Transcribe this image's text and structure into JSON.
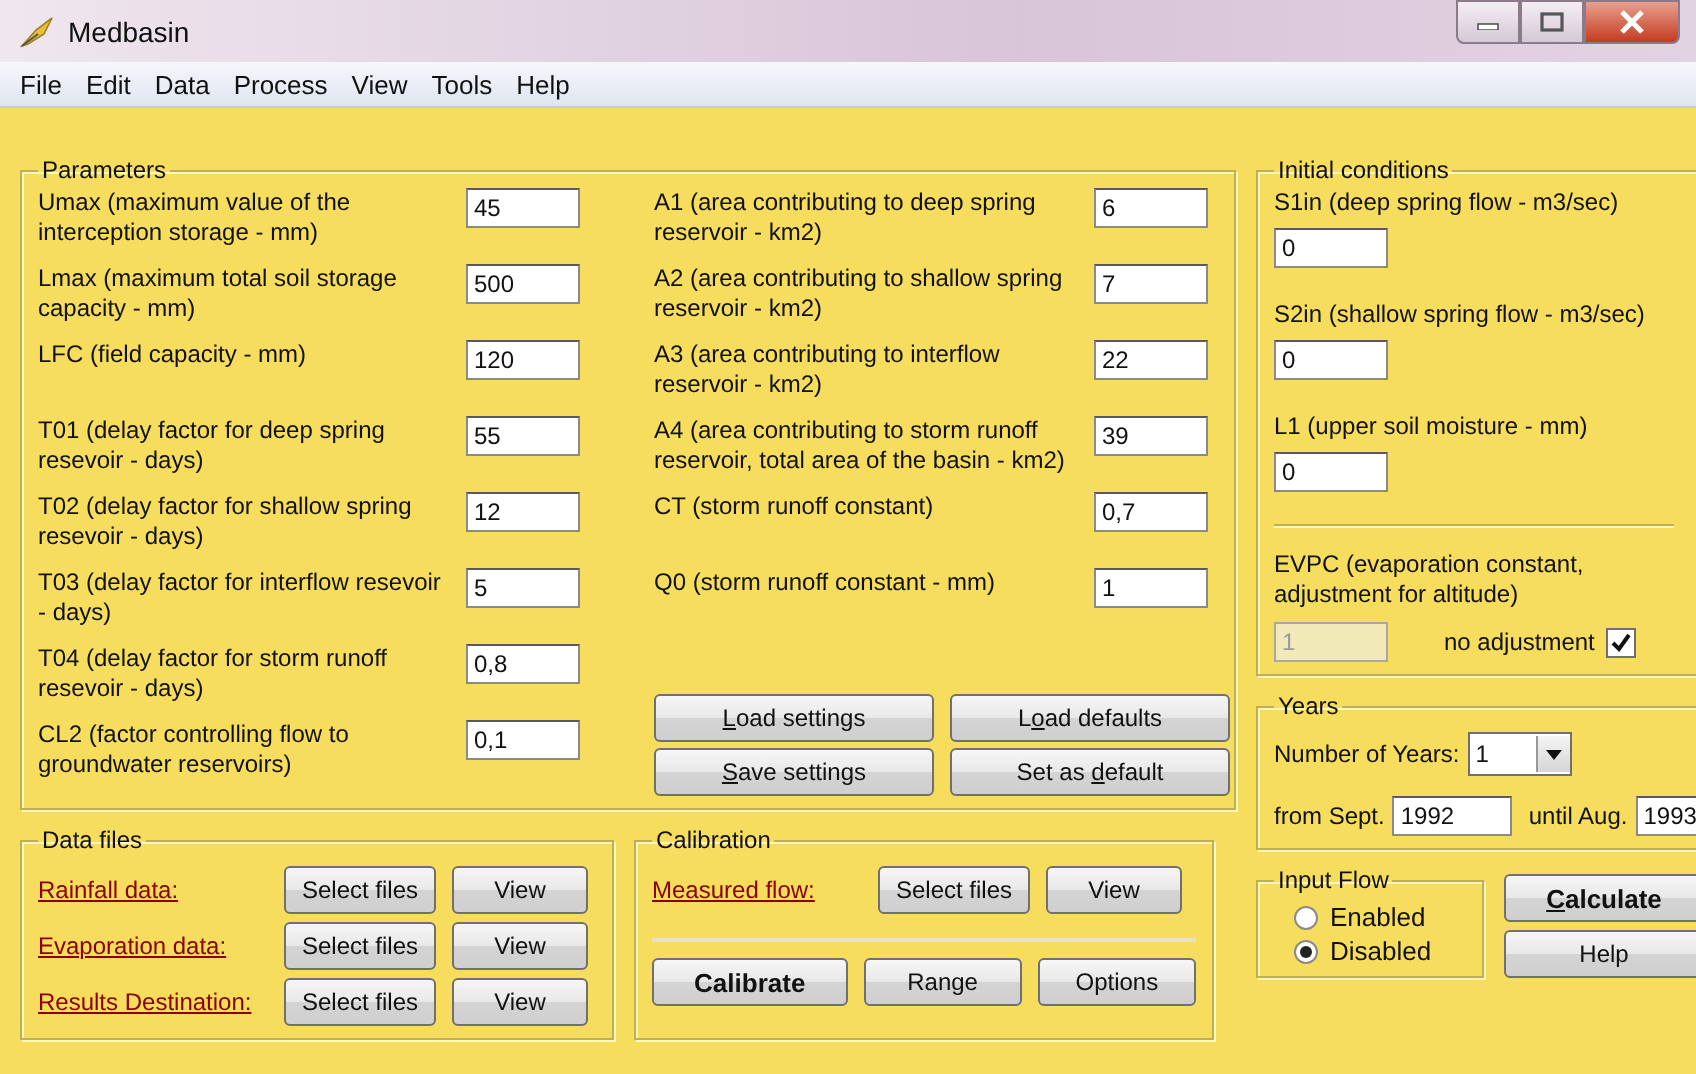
{
  "window": {
    "title": "Medbasin"
  },
  "menu": [
    "File",
    "Edit",
    "Data",
    "Process",
    "View",
    "Tools",
    "Help"
  ],
  "parameters": {
    "title": "Parameters",
    "left": [
      {
        "label": "Umax (maximum value of the interception storage - mm)",
        "value": "45"
      },
      {
        "label": "Lmax (maximum total soil storage capacity - mm)",
        "value": "500"
      },
      {
        "label": "LFC (field capacity - mm)",
        "value": "120"
      },
      {
        "label": "T01 (delay factor for deep spring resevoir - days)",
        "value": "55"
      },
      {
        "label": "T02 (delay factor for shallow spring resevoir - days)",
        "value": "12"
      },
      {
        "label": "T03 (delay factor for interflow resevoir - days)",
        "value": "5"
      },
      {
        "label": "T04 (delay factor for storm runoff resevoir - days)",
        "value": "0,8"
      },
      {
        "label": "CL2  (factor controlling flow to groundwater reservoirs)",
        "value": "0,1"
      }
    ],
    "right": [
      {
        "label": "A1 (area contributing to deep spring reservoir - km2)",
        "value": "6"
      },
      {
        "label": "A2 (area contributing to shallow spring reservoir - km2)",
        "value": "7"
      },
      {
        "label": "A3 (area contributing to interflow reservoir - km2)",
        "value": "22"
      },
      {
        "label": "A4 (area contributing to storm runoff reservoir, total area of the basin - km2)",
        "value": "39"
      },
      {
        "label": "CT (storm runoff constant)",
        "value": "0,7"
      },
      {
        "label": "Q0 (storm runoff constant - mm)",
        "value": "1"
      }
    ],
    "buttons": [
      {
        "key": "L",
        "rest": "oad settings"
      },
      {
        "lead": "L",
        "key": "o",
        "rest": "ad defaults"
      },
      {
        "key": "S",
        "rest": "ave settings"
      },
      {
        "lead": "Set as ",
        "key": "d",
        "rest": "efault"
      }
    ]
  },
  "data_files": {
    "title": "Data files",
    "rows": [
      {
        "label": "Rainfall data:",
        "select": "Select files",
        "view": "View"
      },
      {
        "label": "Evaporation data:",
        "select": "Select files",
        "view": "View"
      },
      {
        "label": "Results Destination:",
        "select": "Select files",
        "view": "View"
      }
    ]
  },
  "calibration": {
    "title": "Calibration",
    "rows": [
      {
        "label": "Measured flow:",
        "select": "Select files",
        "view": "View"
      }
    ],
    "buttons": [
      {
        "label": "Calibrate",
        "kind": "primary"
      },
      {
        "label": "Range",
        "kind": "normal"
      },
      {
        "label": "Options",
        "kind": "normal"
      }
    ]
  },
  "initial_conditions": {
    "title": "Initial conditions",
    "fields": [
      {
        "label": "S1in (deep spring flow - m3/sec)",
        "value": "0"
      },
      {
        "label": "S2in (shallow spring flow - m3/sec)",
        "value": "0"
      },
      {
        "label": "L1 (upper soil moisture - mm)",
        "value": "0"
      }
    ],
    "evpc": {
      "label": "EVPC (evaporation constant, adjustment for altitude)",
      "value": "1",
      "disabled": true,
      "checkbox_label": "no adjustment",
      "checked": true
    }
  },
  "years": {
    "title": "Years",
    "count_label": "Number of Years:",
    "count": "1",
    "from_label": "from Sept.",
    "from": "1992",
    "until_label": "until Aug.",
    "until": "1993"
  },
  "input_flow": {
    "title": "Input Flow",
    "options": [
      {
        "label": "Enabled",
        "selected": false
      },
      {
        "label": "Disabled",
        "selected": true
      }
    ]
  },
  "actions": [
    {
      "key": "C",
      "rest": "alculate",
      "kind": "primary"
    },
    {
      "rest": "Help",
      "kind": "normal"
    }
  ]
}
